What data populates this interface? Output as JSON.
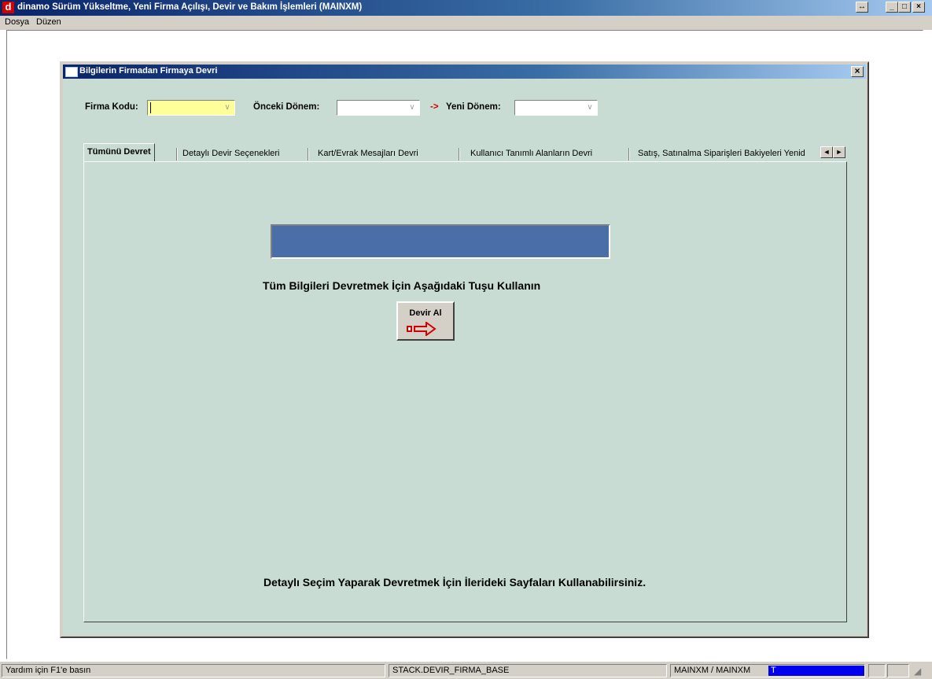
{
  "window": {
    "logo_letter": "d",
    "title": "dinamo Sürüm Yükseltme, Yeni Firma Açılışı, Devir ve Bakım İşlemleri (MAINXM)",
    "controls": {
      "restore": "↔",
      "minimize": "_",
      "maximize": "□",
      "close": "×"
    }
  },
  "menu": [
    "Dosya",
    "Düzen"
  ],
  "dialog": {
    "title": "Bilgilerin Firmadan Firmaya Devri",
    "close": "×",
    "firma_kodu_label": "Firma Kodu:",
    "firma_kodu_value": "",
    "onceki_donem_label": "Önceki Dönem:",
    "onceki_donem_value": "",
    "arrow_text": "->",
    "yeni_donem_label": "Yeni Dönem:",
    "yeni_donem_value": "",
    "tabs": [
      {
        "label": "Tümünü Devret",
        "active": true
      },
      {
        "label": "Detaylı Devir Seçenekleri"
      },
      {
        "label": "Kart/Evrak Mesajları Devri"
      },
      {
        "label": "Kullanıcı Tanımlı Alanların Devri"
      },
      {
        "label": "Satış, Satınalma Siparişleri Bakiyeleri Yenid"
      }
    ],
    "progress": 1.0,
    "message_top": "Tüm Bilgileri Devretmek İçin Aşağıdaki Tuşu Kullanın",
    "devir_button_label": "Devir Al",
    "message_bottom": "Detaylı Seçim Yaparak Devretmek İçin İlerideki Sayfaları Kullanabilirsiniz."
  },
  "statusbar": {
    "help": "Yardım için F1'e basın",
    "stack": "STACK.DEVIR_FIRMA_BASE",
    "user": "MAINXM / MAINXM",
    "indicator": "T"
  },
  "colors": {
    "titlebar_start": "#0a246a",
    "client_bg": "#c8dcd4",
    "progress_fill": "#4a6fa8",
    "firma_field_bg": "#ffff99",
    "arrow_red": "#d40000"
  }
}
